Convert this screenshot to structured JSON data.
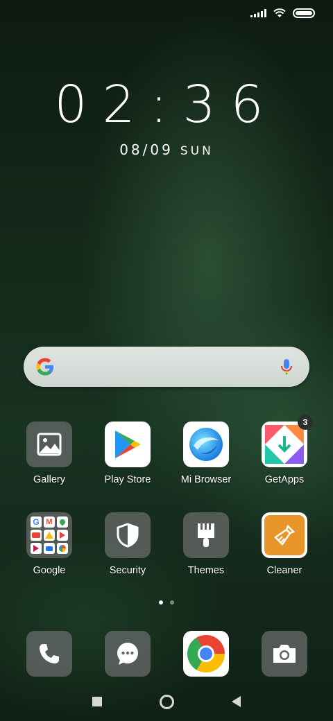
{
  "status_bar": {
    "signal_icon": "signal-bars-icon",
    "wifi_icon": "wifi-icon",
    "battery_icon": "battery-icon"
  },
  "clock": {
    "time": "02:36",
    "date": "08/09",
    "day": "SUN"
  },
  "search_bar": {
    "logo": "google-g-icon",
    "mic": "microphone-icon"
  },
  "apps_row1": [
    {
      "label": "Gallery",
      "icon": "gallery-icon"
    },
    {
      "label": "Play Store",
      "icon": "play-store-icon"
    },
    {
      "label": "Mi Browser",
      "icon": "mi-browser-icon"
    },
    {
      "label": "GetApps",
      "icon": "getapps-icon",
      "badge": "3"
    }
  ],
  "apps_row2": [
    {
      "label": "Google",
      "icon": "google-folder-icon"
    },
    {
      "label": "Security",
      "icon": "shield-icon"
    },
    {
      "label": "Themes",
      "icon": "brush-icon"
    },
    {
      "label": "Cleaner",
      "icon": "cleaner-broom-icon"
    }
  ],
  "page_indicator": {
    "pages": 2,
    "active": 1
  },
  "dock": [
    {
      "icon": "phone-icon"
    },
    {
      "icon": "messaging-icon"
    },
    {
      "icon": "chrome-icon"
    },
    {
      "icon": "camera-icon"
    }
  ],
  "nav_bar": {
    "recents": "square-recents-icon",
    "home": "circle-home-icon",
    "back": "triangle-back-icon"
  },
  "colors": {
    "accent_orange": "#e8952a",
    "google_blue": "#4285F4",
    "google_red": "#EA4335",
    "google_yellow": "#FBBC05",
    "google_green": "#34A853"
  }
}
